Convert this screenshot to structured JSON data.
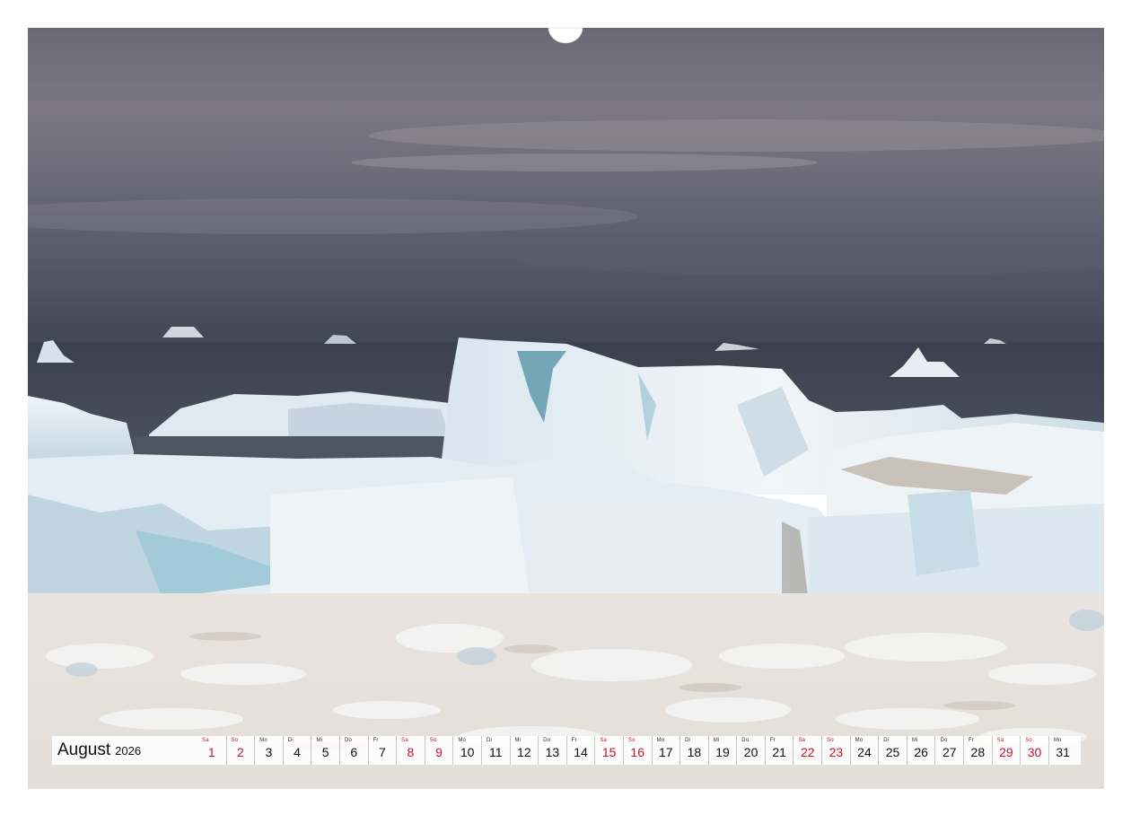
{
  "calendar": {
    "month": "August",
    "year": "2026",
    "weekend_color": "#c0172a",
    "days": [
      {
        "wd": "Sa",
        "n": "1",
        "we": true
      },
      {
        "wd": "So",
        "n": "2",
        "we": true
      },
      {
        "wd": "Mo",
        "n": "3",
        "we": false
      },
      {
        "wd": "Di",
        "n": "4",
        "we": false
      },
      {
        "wd": "Mi",
        "n": "5",
        "we": false
      },
      {
        "wd": "Do",
        "n": "6",
        "we": false
      },
      {
        "wd": "Fr",
        "n": "7",
        "we": false
      },
      {
        "wd": "Sa",
        "n": "8",
        "we": true
      },
      {
        "wd": "So",
        "n": "9",
        "we": true
      },
      {
        "wd": "Mo",
        "n": "10",
        "we": false
      },
      {
        "wd": "Di",
        "n": "11",
        "we": false
      },
      {
        "wd": "Mi",
        "n": "12",
        "we": false
      },
      {
        "wd": "Do",
        "n": "13",
        "we": false
      },
      {
        "wd": "Fr",
        "n": "14",
        "we": false
      },
      {
        "wd": "Sa",
        "n": "15",
        "we": true
      },
      {
        "wd": "So",
        "n": "16",
        "we": true
      },
      {
        "wd": "Mo",
        "n": "17",
        "we": false
      },
      {
        "wd": "Di",
        "n": "18",
        "we": false
      },
      {
        "wd": "Mi",
        "n": "19",
        "we": false
      },
      {
        "wd": "Do",
        "n": "20",
        "we": false
      },
      {
        "wd": "Fr",
        "n": "21",
        "we": false
      },
      {
        "wd": "Sa",
        "n": "22",
        "we": true
      },
      {
        "wd": "So",
        "n": "23",
        "we": true
      },
      {
        "wd": "Mo",
        "n": "24",
        "we": false
      },
      {
        "wd": "Di",
        "n": "25",
        "we": false
      },
      {
        "wd": "Mi",
        "n": "26",
        "we": false
      },
      {
        "wd": "Do",
        "n": "27",
        "we": false
      },
      {
        "wd": "Fr",
        "n": "28",
        "we": false
      },
      {
        "wd": "Sa",
        "n": "29",
        "we": true
      },
      {
        "wd": "So",
        "n": "30",
        "we": true
      },
      {
        "wd": "Mo",
        "n": "31",
        "we": false
      }
    ]
  },
  "binding": {
    "icon": "spiral-binding-holes"
  },
  "photo": {
    "icon": "iceberg-landscape-photo"
  }
}
